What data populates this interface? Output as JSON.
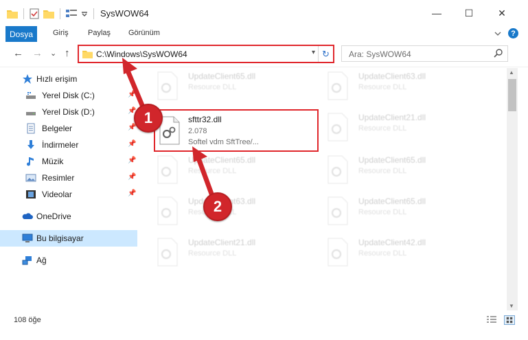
{
  "window": {
    "title": "SysWOW64",
    "minimize": "—",
    "maximize": "☐",
    "close": "✕"
  },
  "ribbon": {
    "file_tab": "Dosya",
    "tabs": [
      "Giriş",
      "Paylaş",
      "Görünüm"
    ]
  },
  "nav": {
    "back": "←",
    "forward": "→",
    "recent": "⌄",
    "up": "↑",
    "address": "C:\\Windows\\SysWOW64",
    "search_placeholder": "Ara: SysWOW64"
  },
  "sidebar": {
    "items": [
      {
        "label": "Hızlı erişim",
        "icon": "star-icon"
      },
      {
        "label": "Yerel Disk (C:)",
        "icon": "drive-icon",
        "pin": "📌"
      },
      {
        "label": "Yerel Disk (D:)",
        "icon": "drive-icon",
        "pin": "📌"
      },
      {
        "label": "Belgeler",
        "icon": "documents-icon",
        "pin": "📌"
      },
      {
        "label": "İndirmeler",
        "icon": "download-icon",
        "pin": "📌"
      },
      {
        "label": "Müzik",
        "icon": "music-icon",
        "pin": "📌"
      },
      {
        "label": "Resimler",
        "icon": "pictures-icon",
        "pin": "📌"
      },
      {
        "label": "Videolar",
        "icon": "videos-icon",
        "pin": "📌"
      },
      {
        "label": "OneDrive",
        "icon": "cloud-icon"
      },
      {
        "label": "Bu bilgisayar",
        "icon": "computer-icon"
      },
      {
        "label": "Ağ",
        "icon": "network-icon"
      }
    ]
  },
  "files": [
    {
      "name": "UpdateClient65.dll",
      "line2": "Resource DLL",
      "line3": ""
    },
    {
      "name": "UpdateClient63.dll",
      "line2": "Resource DLL",
      "line3": ""
    },
    {
      "name": "sfttr32.dll",
      "line2": "2.078",
      "line3": "Softel vdm SftTree/..."
    },
    {
      "name": "UpdateClient21.dll",
      "line2": "Resource DLL",
      "line3": ""
    },
    {
      "name": "UpdateClient65.dll",
      "line2": "Resource DLL",
      "line3": ""
    },
    {
      "name": "UpdateClient65.dll",
      "line2": "Resource DLL",
      "line3": ""
    },
    {
      "name": "UpdateClient63.dll",
      "line2": "Resource DLL",
      "line3": ""
    },
    {
      "name": "UpdateClient65.dll",
      "line2": "Resource DLL",
      "line3": ""
    },
    {
      "name": "UpdateClient21.dll",
      "line2": "Resource DLL",
      "line3": ""
    },
    {
      "name": "UpdateClient42.dll",
      "line2": "Resource DLL",
      "line3": ""
    }
  ],
  "callouts": {
    "one": "1",
    "two": "2"
  },
  "status": {
    "item_count": "108 öğe"
  },
  "colors": {
    "accent": "#1979ca",
    "highlight": "#e0262b",
    "selected": "#cce8ff"
  }
}
